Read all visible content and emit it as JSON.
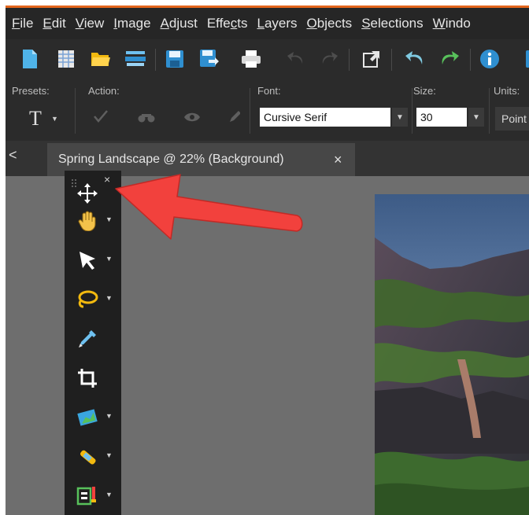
{
  "menu": {
    "items": [
      {
        "key": "F",
        "rest": "ile"
      },
      {
        "key": "E",
        "rest": "dit"
      },
      {
        "key": "V",
        "rest": "iew"
      },
      {
        "key": "I",
        "rest": "mage"
      },
      {
        "key": "A",
        "rest": "djust"
      },
      {
        "pre": "Effe",
        "key": "c",
        "rest": "ts"
      },
      {
        "key": "L",
        "rest": "ayers"
      },
      {
        "key": "O",
        "rest": "bjects"
      },
      {
        "key": "S",
        "rest": "elections"
      },
      {
        "key": "W",
        "rest": "indo"
      }
    ]
  },
  "toolbar": {
    "icons": [
      "new-document-icon",
      "grid-icon",
      "open-folder-icon",
      "scan-icon",
      "save-icon",
      "save-as-icon",
      "print-icon",
      "undo-icon",
      "redo-icon",
      "export-icon",
      "undo-history-icon",
      "redo-history-icon",
      "info-icon"
    ]
  },
  "tool_options": {
    "presets_label": "Presets:",
    "action_label": "Action:",
    "font_label": "Font:",
    "font_value": "Cursive Serif",
    "size_label": "Size:",
    "size_value": "30",
    "units_label": "Units:",
    "units_value": "Point"
  },
  "tab": {
    "title": "Spring Landscape @  22% (Background)",
    "close": "×",
    "nav": "<"
  },
  "tools_palette": {
    "close": "×",
    "tools": [
      "pan-move-icon",
      "pan-hand-icon",
      "pick-arrow-icon",
      "lasso-selection-icon",
      "dropper-icon",
      "crop-icon",
      "straighten-icon",
      "retouch-brush-icon",
      "red-eye-icon"
    ]
  },
  "colors": {
    "accent": "#e3661d",
    "annotation_arrow": "#f2413d"
  }
}
